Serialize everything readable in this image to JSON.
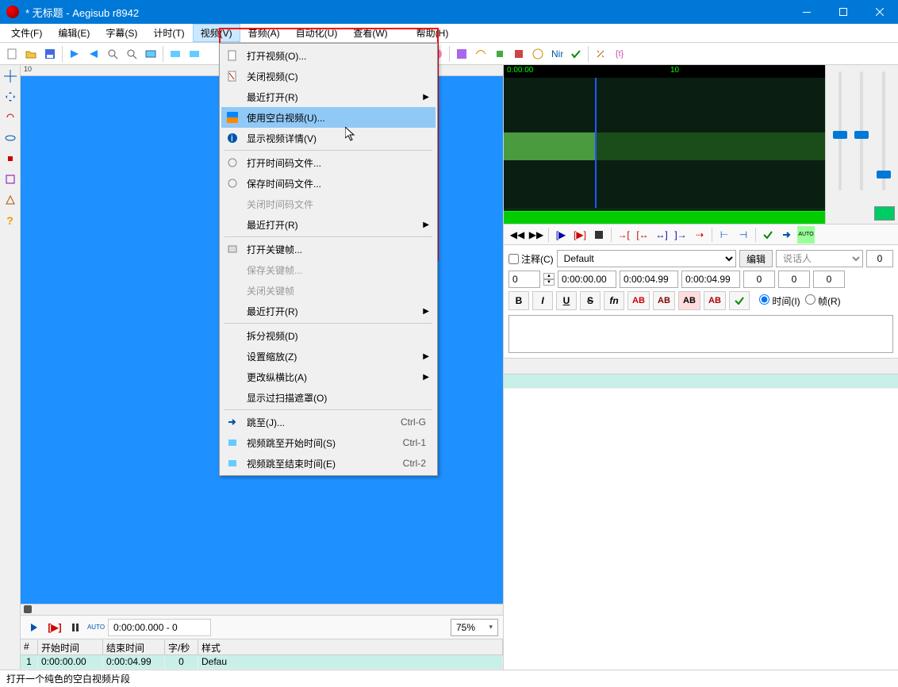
{
  "window": {
    "title": "* 无标题 - Aegisub r8942"
  },
  "menubar": {
    "items": [
      "文件(F)",
      "编辑(E)",
      "字幕(S)",
      "计时(T)",
      "视频(V)",
      "音频(A)",
      "自动化(U)",
      "查看(W)",
      "帮助(H)"
    ],
    "open_index": 4
  },
  "dropdown": {
    "groups": [
      [
        {
          "label": "打开视频(O)...",
          "icon": "file-icon"
        },
        {
          "label": "关闭视频(C)",
          "icon": "close-file-icon"
        },
        {
          "label": "最近打开(R)",
          "submenu": true
        },
        {
          "label": "使用空白视频(U)...",
          "icon": "blank-video-icon",
          "highlight": true
        },
        {
          "label": "显示视频详情(V)",
          "icon": "info-icon"
        }
      ],
      [
        {
          "label": "打开时间码文件...",
          "icon": "clock-open-icon"
        },
        {
          "label": "保存时间码文件...",
          "icon": "clock-save-icon"
        },
        {
          "label": "关闭时间码文件",
          "disabled": true
        },
        {
          "label": "最近打开(R)",
          "submenu": true
        }
      ],
      [
        {
          "label": "打开关键帧...",
          "icon": "key-open-icon"
        },
        {
          "label": "保存关键帧...",
          "disabled": true
        },
        {
          "label": "关闭关键帧",
          "disabled": true
        },
        {
          "label": "最近打开(R)",
          "submenu": true
        }
      ],
      [
        {
          "label": "拆分视频(D)"
        },
        {
          "label": "设置缩放(Z)",
          "submenu": true
        },
        {
          "label": "更改纵横比(A)",
          "submenu": true
        },
        {
          "label": "显示过扫描遮罩(O)"
        }
      ],
      [
        {
          "label": "跳至(J)...",
          "icon": "arrow-right-icon",
          "shortcut": "Ctrl-G"
        },
        {
          "label": "视频跳至开始时间(S)",
          "icon": "jump-start-icon",
          "shortcut": "Ctrl-1"
        },
        {
          "label": "视频跳至结束时间(E)",
          "icon": "jump-end-icon",
          "shortcut": "Ctrl-2"
        }
      ]
    ]
  },
  "video_controls": {
    "time_display": "0:00:00.000 - 0",
    "zoom": "75%"
  },
  "audio": {
    "ruler": {
      "start": "0:00:00",
      "mid": "10"
    }
  },
  "edit": {
    "comment_label": "注释(C)",
    "style": "Default",
    "edit_btn": "编辑",
    "actor_placeholder": "说话人",
    "effect": "0",
    "layer": "0",
    "start": "0:00:00.00",
    "end": "0:00:04.99",
    "duration": "0:00:04.99",
    "margin_l": "0",
    "margin_r": "0",
    "margin_v": "0",
    "radio_time": "时间(I)",
    "radio_frame": "帧(R)"
  },
  "grid": {
    "headers": [
      "#",
      "开始时间",
      "结束时间",
      "字/秒",
      "样式"
    ],
    "row": {
      "num": "1",
      "start": "0:00:00.00",
      "end": "0:00:04.99",
      "cps": "0",
      "style": "Defau"
    }
  },
  "statusbar": {
    "text": "打开一个纯色的空白视频片段"
  }
}
